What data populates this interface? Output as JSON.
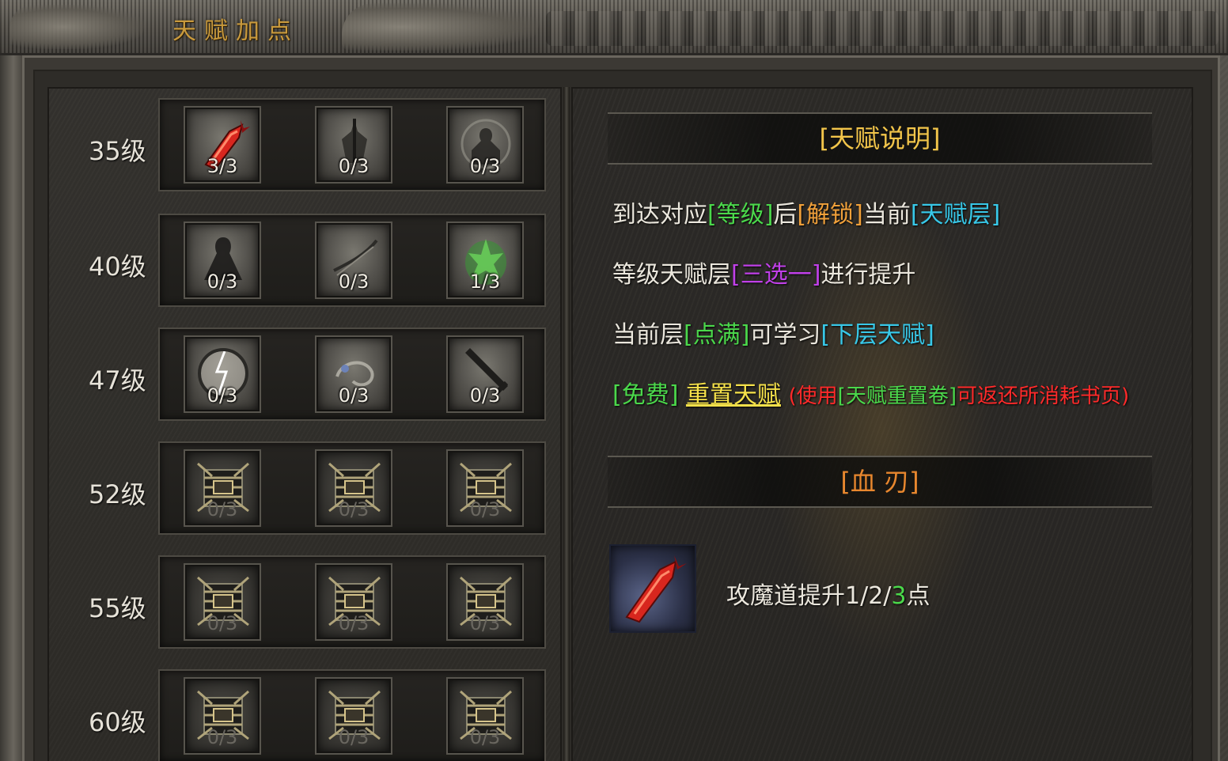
{
  "window": {
    "title": "天赋加点"
  },
  "tiers": [
    {
      "label": "35级",
      "skills": [
        {
          "icon": "red-blade-icon",
          "count": "3/3",
          "locked": false
        },
        {
          "icon": "dark-warrior-icon",
          "count": "0/3",
          "locked": false
        },
        {
          "icon": "shadow-figure-icon",
          "count": "0/3",
          "locked": false
        }
      ]
    },
    {
      "label": "40级",
      "skills": [
        {
          "icon": "cloaked-figure-icon",
          "count": "0/3",
          "locked": false
        },
        {
          "icon": "blade-slash-icon",
          "count": "0/3",
          "locked": false
        },
        {
          "icon": "green-aura-icon",
          "count": "1/3",
          "locked": false
        }
      ]
    },
    {
      "label": "47级",
      "skills": [
        {
          "icon": "lightning-orb-icon",
          "count": "0/3",
          "locked": false
        },
        {
          "icon": "whirl-icon",
          "count": "0/3",
          "locked": false
        },
        {
          "icon": "greatsword-icon",
          "count": "0/3",
          "locked": false
        }
      ]
    },
    {
      "label": "52级",
      "skills": [
        {
          "icon": "chain-lock-icon",
          "count": "0/3",
          "locked": true
        },
        {
          "icon": "chain-lock-icon",
          "count": "0/3",
          "locked": true
        },
        {
          "icon": "chain-lock-icon",
          "count": "0/3",
          "locked": true
        }
      ]
    },
    {
      "label": "55级",
      "skills": [
        {
          "icon": "chain-lock-icon",
          "count": "0/3",
          "locked": true
        },
        {
          "icon": "chain-lock-icon",
          "count": "0/3",
          "locked": true
        },
        {
          "icon": "chain-lock-icon",
          "count": "0/3",
          "locked": true
        }
      ]
    },
    {
      "label": "60级",
      "skills": [
        {
          "icon": "chain-lock-icon",
          "count": "0/3",
          "locked": true
        },
        {
          "icon": "chain-lock-icon",
          "count": "0/3",
          "locked": true
        },
        {
          "icon": "chain-lock-icon",
          "count": "0/3",
          "locked": true
        }
      ]
    }
  ],
  "info": {
    "header": "[天赋说明]",
    "line1": {
      "a": "到达对应",
      "b": "[等级]",
      "c": "后",
      "d": "[解锁]",
      "e": "当前",
      "f": "[天赋层]"
    },
    "line2": {
      "a": "等级天赋层",
      "b": "[三选一]",
      "c": "进行提升"
    },
    "line3": {
      "a": "当前层",
      "b": "[点满]",
      "c": "可学习",
      "d": "[下层天赋]"
    },
    "line4": {
      "a": "[免费]",
      "b": "重置天赋",
      "c": "(使用",
      "d": "[天赋重置卷]",
      "e": "可返还所消耗书页)"
    }
  },
  "selected": {
    "header": "[血 刃]",
    "icon": "red-blade-icon",
    "desc_a": "攻魔道提升1/2/",
    "desc_b": "3",
    "desc_c": "点"
  },
  "colors": {
    "gold": "#f2c54a",
    "green": "#4bd84b",
    "orange": "#f0a03a",
    "cyan": "#38c8e8",
    "magenta": "#c040e8",
    "red": "#ff2a2a"
  }
}
